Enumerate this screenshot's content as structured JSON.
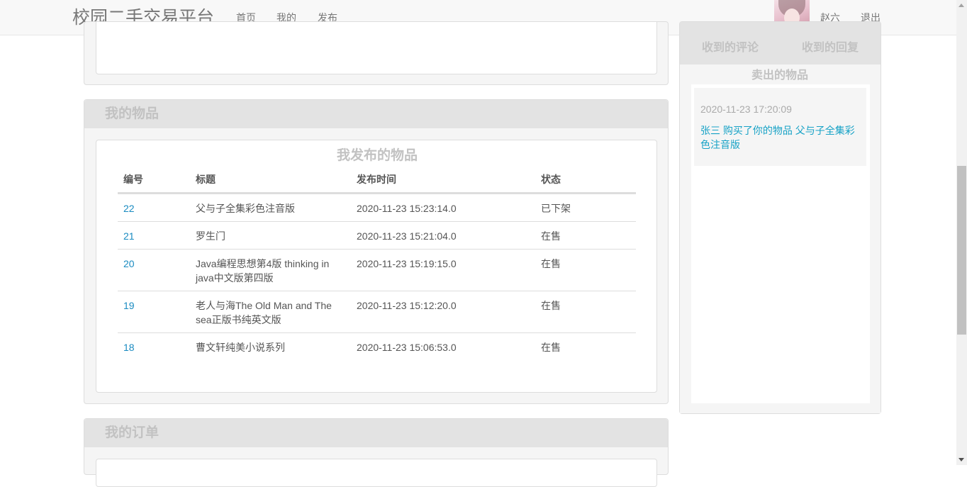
{
  "navbar": {
    "brand": "校园二手交易平台",
    "links": [
      "首页",
      "我的",
      "发布"
    ],
    "username": "赵六",
    "logout": "退出"
  },
  "my_items": {
    "panel_title": "我的物品",
    "table_title": "我发布的物品",
    "columns": [
      "编号",
      "标题",
      "发布时间",
      "状态"
    ],
    "rows": [
      {
        "id": "22",
        "title": "父与子全集彩色注音版",
        "time": "2020-11-23 15:23:14.0",
        "status": "已下架"
      },
      {
        "id": "21",
        "title": "罗生门",
        "time": "2020-11-23 15:21:04.0",
        "status": "在售"
      },
      {
        "id": "20",
        "title": "Java编程思想第4版 thinking in java中文版第四版",
        "time": "2020-11-23 15:19:15.0",
        "status": "在售"
      },
      {
        "id": "19",
        "title": "老人与海The Old Man and The sea正版书纯英文版",
        "time": "2020-11-23 15:12:20.0",
        "status": "在售"
      },
      {
        "id": "18",
        "title": "曹文轩纯美小说系列",
        "time": "2020-11-23 15:06:53.0",
        "status": "在售"
      }
    ]
  },
  "my_orders": {
    "panel_title": "我的订单"
  },
  "notifications": {
    "tabs": [
      "收到的评论",
      "收到的回复"
    ],
    "sold_title": "卖出的物品",
    "sold_messages": [
      {
        "time": "2020-11-23 17:20:09",
        "text": "张三 购买了你的物品 父与子全集彩色注音版"
      }
    ]
  },
  "colors": {
    "link": "#1a8bc1",
    "message_link": "#17a2c6",
    "panel_heading_bg": "#e3e3e3",
    "heading_text": "#c2c2c2"
  }
}
